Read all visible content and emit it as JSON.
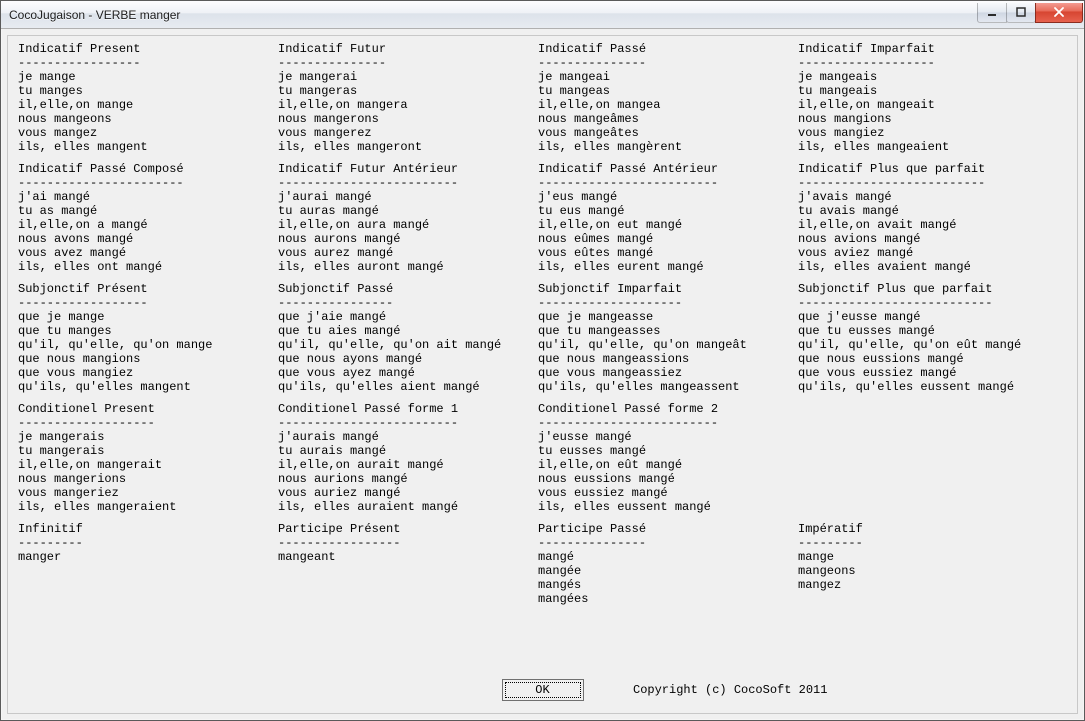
{
  "window": {
    "title": "CocoJugaison - VERBE manger"
  },
  "footer": {
    "ok_label": "OK",
    "copyright": "Copyright (c) CocoSoft 2011"
  },
  "blocks": [
    {
      "title": "Indicatif Present",
      "lines": [
        "je mange",
        "tu manges",
        "il,elle,on mange",
        "nous mangeons",
        "vous mangez",
        "ils, elles mangent"
      ]
    },
    {
      "title": "Indicatif Futur",
      "lines": [
        "je mangerai",
        "tu mangeras",
        "il,elle,on mangera",
        "nous mangerons",
        "vous mangerez",
        "ils, elles mangeront"
      ]
    },
    {
      "title": "Indicatif Passé",
      "lines": [
        "je mangeai",
        "tu mangeas",
        "il,elle,on mangea",
        "nous mangeâmes",
        "vous mangeâtes",
        "ils, elles mangèrent"
      ]
    },
    {
      "title": "Indicatif Imparfait",
      "lines": [
        "je mangeais",
        "tu mangeais",
        "il,elle,on mangeait",
        "nous mangions",
        "vous mangiez",
        "ils, elles mangeaient"
      ]
    },
    {
      "title": "Indicatif Passé Composé",
      "lines": [
        "j'ai mangé",
        "tu as mangé",
        "il,elle,on a mangé",
        "nous avons mangé",
        "vous avez mangé",
        "ils, elles ont mangé"
      ]
    },
    {
      "title": "Indicatif Futur Antérieur",
      "lines": [
        "j'aurai mangé",
        "tu auras mangé",
        "il,elle,on aura mangé",
        "nous aurons mangé",
        "vous aurez mangé",
        "ils, elles auront mangé"
      ]
    },
    {
      "title": "Indicatif Passé Antérieur",
      "lines": [
        "j'eus mangé",
        "tu eus mangé",
        "il,elle,on eut mangé",
        "nous eûmes mangé",
        "vous eûtes mangé",
        "ils, elles eurent mangé"
      ]
    },
    {
      "title": "Indicatif Plus que parfait",
      "lines": [
        "j'avais mangé",
        "tu avais mangé",
        "il,elle,on avait mangé",
        "nous avions mangé",
        "vous aviez mangé",
        "ils, elles avaient mangé"
      ]
    },
    {
      "title": "Subjonctif Présent",
      "lines": [
        "que je mange",
        "que tu manges",
        "qu'il, qu'elle, qu'on mange",
        "que nous mangions",
        "que vous mangiez",
        "qu'ils, qu'elles mangent"
      ]
    },
    {
      "title": "Subjonctif Passé",
      "lines": [
        "que j'aie mangé",
        "que tu aies mangé",
        "qu'il, qu'elle, qu'on ait mangé",
        "que nous ayons mangé",
        "que vous ayez mangé",
        "qu'ils, qu'elles aient mangé"
      ]
    },
    {
      "title": "Subjonctif Imparfait",
      "lines": [
        "que je mangeasse",
        "que tu mangeasses",
        "qu'il, qu'elle, qu'on mangeât",
        "que nous mangeassions",
        "que vous mangeassiez",
        "qu'ils, qu'elles mangeassent"
      ]
    },
    {
      "title": "Subjonctif Plus que parfait",
      "lines": [
        "que j'eusse mangé",
        "que tu eusses mangé",
        "qu'il, qu'elle, qu'on eût mangé",
        "que nous eussions mangé",
        "que vous eussiez mangé",
        "qu'ils, qu'elles eussent mangé"
      ]
    },
    {
      "title": "Conditionel Present",
      "lines": [
        "je mangerais",
        "tu mangerais",
        "il,elle,on mangerait",
        "nous mangerions",
        "vous mangeriez",
        "ils, elles mangeraient"
      ]
    },
    {
      "title": "Conditionel Passé forme 1",
      "lines": [
        "j'aurais mangé",
        "tu aurais mangé",
        "il,elle,on aurait mangé",
        "nous aurions mangé",
        "vous auriez mangé",
        "ils, elles auraient mangé"
      ]
    },
    {
      "title": "Conditionel Passé forme 2",
      "lines": [
        "j'eusse mangé",
        "tu eusses mangé",
        "il,elle,on eût mangé",
        "nous eussions mangé",
        "vous eussiez mangé",
        "ils, elles eussent mangé"
      ]
    },
    {
      "title": "",
      "lines": []
    },
    {
      "title": "Infinitif",
      "lines": [
        "manger"
      ]
    },
    {
      "title": "Participe Présent",
      "lines": [
        "mangeant"
      ]
    },
    {
      "title": "Participe Passé",
      "lines": [
        "mangé",
        "mangée",
        "mangés",
        "mangées"
      ]
    },
    {
      "title": "Impératif",
      "lines": [
        "mange",
        "mangeons",
        "mangez"
      ]
    }
  ]
}
